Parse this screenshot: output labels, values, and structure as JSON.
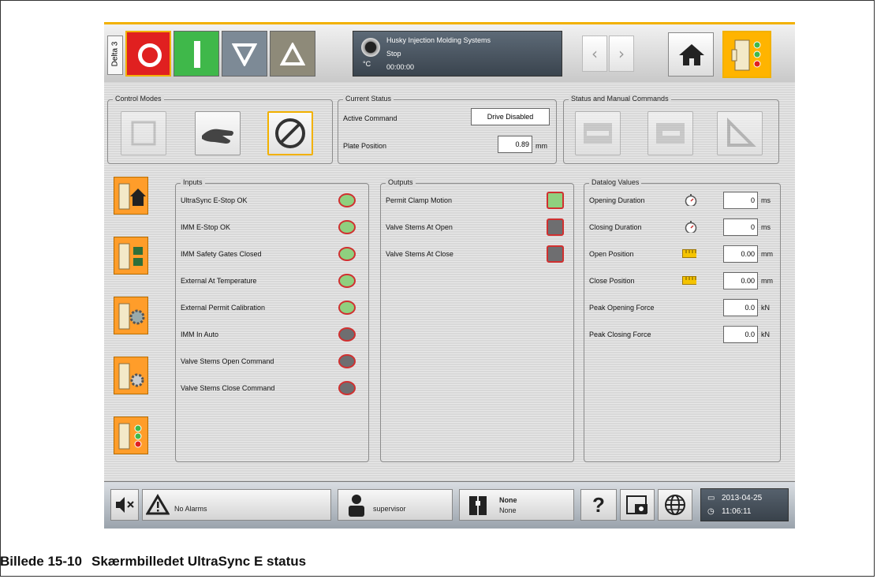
{
  "header": {
    "station": "Delta 3",
    "unit": "°C",
    "company": "Husky Injection Molding Systems",
    "state": "Stop",
    "timer": "00:00:00",
    "nav_back": "‹",
    "nav_forward": "›"
  },
  "control_modes": {
    "title": "Control Modes"
  },
  "current_status": {
    "title": "Current Status",
    "active_command_label": "Active Command",
    "active_command_value": "Drive Disabled",
    "plate_position_label": "Plate Position",
    "plate_position_value": "0.89",
    "plate_position_unit": "mm"
  },
  "status_commands": {
    "title": "Status and Manual Commands"
  },
  "inputs": {
    "title": "Inputs",
    "items": [
      {
        "label": "UltraSync E-Stop OK",
        "state": "on"
      },
      {
        "label": "IMM E-Stop OK",
        "state": "on"
      },
      {
        "label": "IMM Safety Gates Closed",
        "state": "on"
      },
      {
        "label": "External At Temperature",
        "state": "on"
      },
      {
        "label": "External Permit Calibration",
        "state": "on"
      },
      {
        "label": "IMM In Auto",
        "state": "off"
      },
      {
        "label": "Valve Stems Open Command",
        "state": "off"
      },
      {
        "label": "Valve Stems Close Command",
        "state": "off"
      }
    ]
  },
  "outputs": {
    "title": "Outputs",
    "items": [
      {
        "label": "Permit Clamp Motion",
        "state": "on"
      },
      {
        "label": "Valve Stems At Open",
        "state": "off"
      },
      {
        "label": "Valve Stems At Close",
        "state": "off"
      }
    ]
  },
  "datalog": {
    "title": "Datalog Values",
    "items": [
      {
        "label": "Opening Duration",
        "value": "0",
        "unit": "ms",
        "icon": "stopwatch-icon"
      },
      {
        "label": "Closing Duration",
        "value": "0",
        "unit": "ms",
        "icon": "stopwatch-icon"
      },
      {
        "label": "Open Position",
        "value": "0.00",
        "unit": "mm",
        "icon": "ruler-icon"
      },
      {
        "label": "Close Position",
        "value": "0.00",
        "unit": "mm",
        "icon": "ruler-icon"
      },
      {
        "label": "Peak Opening Force",
        "value": "0.0",
        "unit": "kN",
        "icon": ""
      },
      {
        "label": "Peak Closing Force",
        "value": "0.0",
        "unit": "kN",
        "icon": ""
      }
    ]
  },
  "footer": {
    "alarms": "No Alarms",
    "user": "supervisor",
    "mold_top": "None",
    "mold_bottom": "None",
    "help": "?",
    "date": "2013-04-25",
    "time": "11:06:11"
  },
  "caption": {
    "number": "Billede 15-10",
    "text": "Skærmbilledet UltraSync E status"
  },
  "colors": {
    "accent": "#f2b100",
    "led_on": "#8fd07f",
    "led_off": "#6e6e70",
    "led_ring": "#d03030",
    "stop_red": "#e02020",
    "start_green": "#3fb84a"
  }
}
